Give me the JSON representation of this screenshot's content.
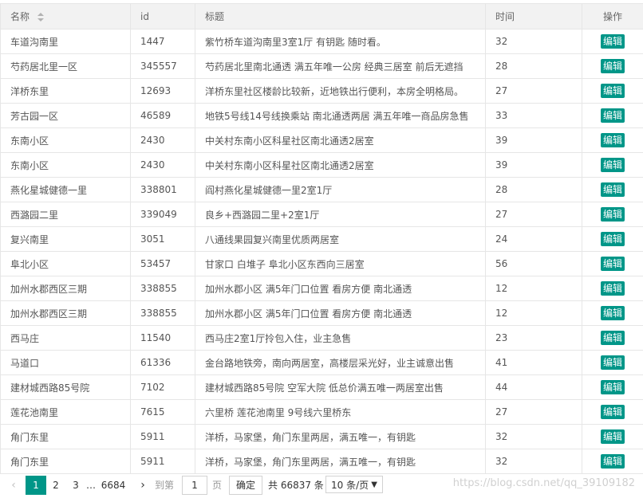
{
  "columns": {
    "name": "名称",
    "id": "id",
    "title": "标题",
    "time": "时间",
    "op": "操作"
  },
  "edit_label": "编辑",
  "rows": [
    {
      "name": "车道沟南里",
      "id": "1447",
      "title": "紫竹桥车道沟南里3室1厅 有钥匙 随时看。",
      "time": "32"
    },
    {
      "name": "芍药居北里一区",
      "id": "345557",
      "title": "芍药居北里南北通透 满五年唯一公房 经典三居室 前后无遮挡",
      "time": "28"
    },
    {
      "name": "洋桥东里",
      "id": "12693",
      "title": "洋桥东里社区楼龄比较新，近地铁出行便利，本房全明格局。",
      "time": "27"
    },
    {
      "name": "芳古园一区",
      "id": "46589",
      "title": "地铁5号线14号线换乘站 南北通透两居 满五年唯一商品房急售",
      "time": "33"
    },
    {
      "name": "东南小区",
      "id": "2430",
      "title": "中关村东南小区科星社区南北通透2居室",
      "time": "39"
    },
    {
      "name": "东南小区",
      "id": "2430",
      "title": "中关村东南小区科星社区南北通透2居室",
      "time": "39"
    },
    {
      "name": "燕化星城健德一里",
      "id": "338801",
      "title": "阎村燕化星城健德一里2室1厅",
      "time": "28"
    },
    {
      "name": "西潞园二里",
      "id": "339049",
      "title": "良乡+西潞园二里+2室1厅",
      "time": "27"
    },
    {
      "name": "复兴南里",
      "id": "3051",
      "title": "八通线果园复兴南里优质两居室",
      "time": "24"
    },
    {
      "name": "阜北小区",
      "id": "53457",
      "title": "甘家口 白堆子 阜北小区东西向三居室",
      "time": "56"
    },
    {
      "name": "加州水郡西区三期",
      "id": "338855",
      "title": "加州水郡小区 满5年门口位置 看房方便 南北通透",
      "time": "12"
    },
    {
      "name": "加州水郡西区三期",
      "id": "338855",
      "title": "加州水郡小区 满5年门口位置 看房方便 南北通透",
      "time": "12"
    },
    {
      "name": "西马庄",
      "id": "11540",
      "title": "西马庄2室1厅拎包入住，业主急售",
      "time": "23"
    },
    {
      "name": "马道口",
      "id": "61336",
      "title": "金台路地铁旁，南向两居室，高楼层采光好，业主诚意出售",
      "time": "41"
    },
    {
      "name": "建材城西路85号院",
      "id": "7102",
      "title": "建材城西路85号院 空军大院 低总价满五唯一两居室出售",
      "time": "44"
    },
    {
      "name": "莲花池南里",
      "id": "7615",
      "title": "六里桥 莲花池南里 9号线六里桥东",
      "time": "27"
    },
    {
      "name": "角门东里",
      "id": "5911",
      "title": "洋桥，马家堡，角门东里两居，满五唯一，有钥匙",
      "time": "32"
    },
    {
      "name": "角门东里",
      "id": "5911",
      "title": "洋桥，马家堡，角门东里两居，满五唯一，有钥匙",
      "time": "32"
    }
  ],
  "pagination": {
    "prev": "‹",
    "current": "1",
    "page2": "2",
    "page3": "3",
    "ellipsis": "…",
    "last": "6684",
    "next": "›",
    "goto_label": "到第",
    "goto_value": "1",
    "page_label": "页",
    "confirm_label": "确定",
    "total_label": "共 66837 条",
    "page_size": "10 条/页"
  },
  "watermark": "https://blog.csdn.net/qq_39109182",
  "accent_color": "#009688"
}
